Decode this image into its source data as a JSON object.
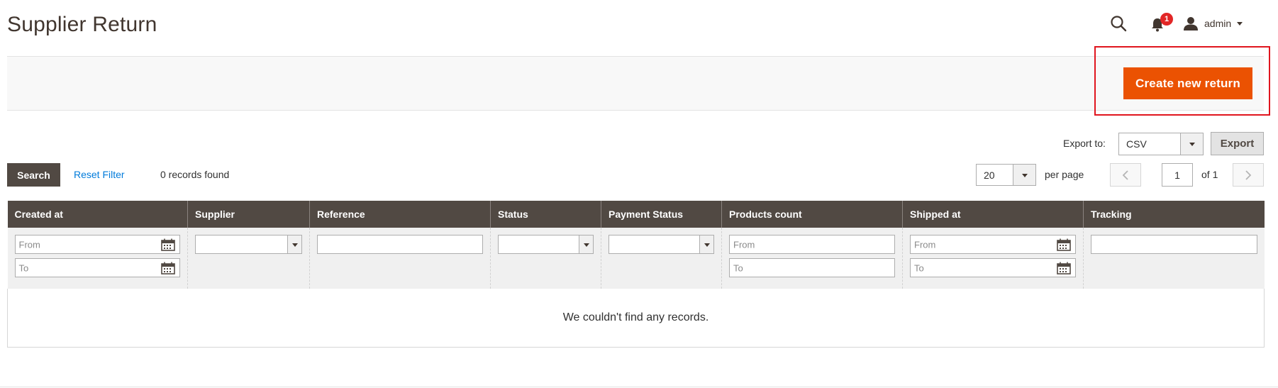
{
  "page": {
    "title": "Supplier Return"
  },
  "header": {
    "notification_count": "1",
    "user_label": "admin"
  },
  "actions": {
    "create_label": "Create new return"
  },
  "export": {
    "label": "Export to:",
    "format": "CSV",
    "button": "Export"
  },
  "toolbar": {
    "search_label": "Search",
    "reset_label": "Reset Filter",
    "records_found": "0 records found",
    "per_page_value": "20",
    "per_page_label": "per page",
    "current_page": "1",
    "of_pages": "of 1"
  },
  "grid": {
    "columns": [
      "Created at",
      "Supplier",
      "Reference",
      "Status",
      "Payment Status",
      "Products count",
      "Shipped at",
      "Tracking"
    ],
    "filters": {
      "from_placeholder": "From",
      "to_placeholder": "To"
    },
    "empty_message": "We couldn't find any records."
  },
  "colors": {
    "accent": "#eb5202",
    "header_bg": "#514943",
    "link": "#007bdb",
    "badge": "#e22626",
    "highlight": "#e0151e"
  },
  "icons": [
    "search-icon",
    "bell-icon",
    "user-icon",
    "calendar-icon",
    "chevron-left-icon",
    "chevron-right-icon"
  ]
}
